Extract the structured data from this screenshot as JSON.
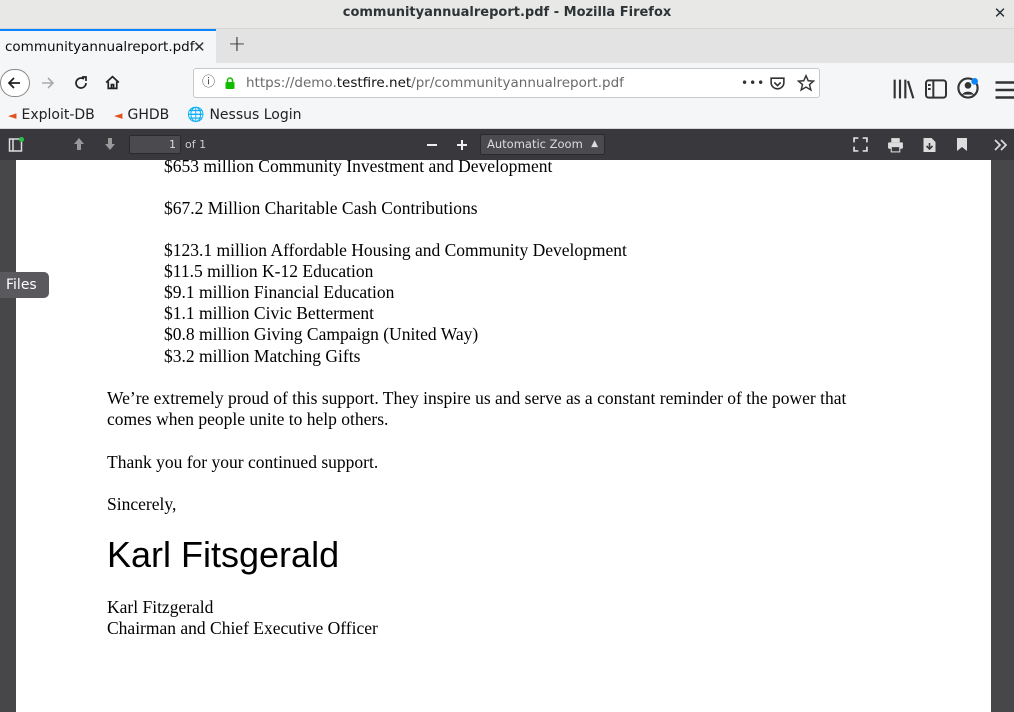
{
  "window": {
    "title": "communityannualreport.pdf - Mozilla Firefox",
    "close_glyph": "✕"
  },
  "tabs": [
    {
      "label": "communityannualreport.pdf",
      "close_glyph": "✕"
    }
  ],
  "newtab_glyph": "+",
  "nav": {
    "back_icon": "arrow-left-icon",
    "forward_icon": "arrow-right-icon",
    "reload_icon": "reload-icon",
    "home_icon": "home-icon",
    "url_prefix": "https://demo.",
    "url_domain": "testfire.net",
    "url_path": "/pr/communityannualreport.pdf",
    "more_glyph": "•••"
  },
  "bookmarks": [
    {
      "label": "Exploit-DB",
      "icon": "exploit-db-icon"
    },
    {
      "label": "GHDB",
      "icon": "ghdb-icon"
    },
    {
      "label": "Nessus Login",
      "icon": "globe-icon"
    }
  ],
  "pdf_toolbar": {
    "page_number": "1",
    "page_count": "of 1",
    "zoom": "Automatic Zoom"
  },
  "files_tooltip": "Files",
  "document": {
    "lines": [
      "$653 million Community Investment and Development",
      "$67.2 Million Charitable Cash Contributions",
      "$123.1 million Affordable Housing and Community Development",
      "$11.5 million K-12 Education",
      "$9.1 million Financial Education",
      "$1.1 million Civic Betterment",
      "$0.8 million Giving Campaign (United Way)",
      "$3.2 million Matching Gifts"
    ],
    "para1_line1": "We’re extremely proud of this support. They inspire us and serve as a constant reminder of the power that",
    "para1_line2": "comes when people unite to help others.",
    "thanks": "Thank you for your continued support.",
    "closing": "Sincerely,",
    "signature": "Karl Fitsgerald",
    "name": "Karl Fitzgerald",
    "role": "Chairman and Chief Executive Officer"
  },
  "colors": {
    "accent": "#0a84ff",
    "toolbar_dark": "#38383d",
    "viewer_bg": "#474749"
  }
}
